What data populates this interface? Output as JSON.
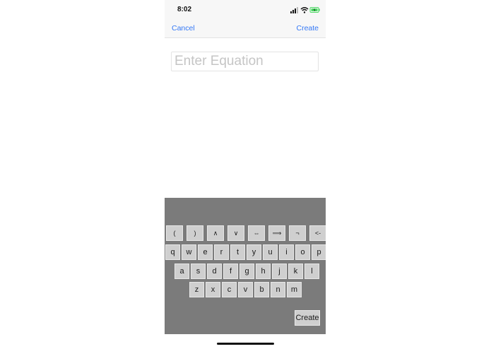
{
  "status_bar": {
    "time": "8:02",
    "icons": [
      "signal-icon",
      "wifi-icon",
      "battery-icon"
    ],
    "battery_color": "#4cd964"
  },
  "nav": {
    "cancel_label": "Cancel",
    "create_label": "Create",
    "accent": "#3478f6"
  },
  "equation_input": {
    "placeholder": "Enter Equation",
    "value": ""
  },
  "keyboard": {
    "background": "#7b7b7b",
    "symbol_row": [
      "(",
      ")",
      "∧",
      "∨",
      "⇔",
      "⟹",
      "¬",
      "<-"
    ],
    "row1": [
      "q",
      "w",
      "e",
      "r",
      "t",
      "y",
      "u",
      "i",
      "o",
      "p"
    ],
    "row2": [
      "a",
      "s",
      "d",
      "f",
      "g",
      "h",
      "j",
      "k",
      "l"
    ],
    "row3": [
      "z",
      "x",
      "c",
      "v",
      "b",
      "n",
      "m"
    ],
    "create_label": "Create"
  }
}
